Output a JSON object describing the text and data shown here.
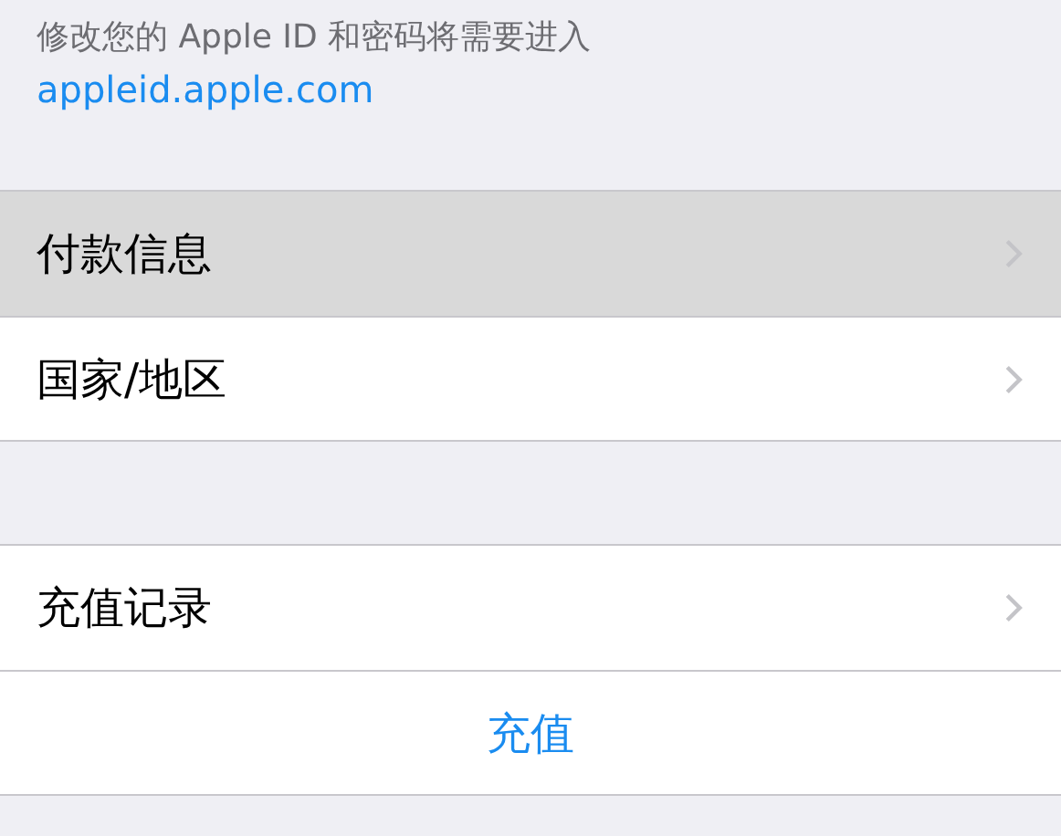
{
  "footer_note": {
    "text": "修改您的 Apple ID 和密码将需要进入",
    "link": "appleid.apple.com"
  },
  "groups": [
    {
      "items": [
        {
          "kind": "nav",
          "label": "付款信息",
          "selected": true
        },
        {
          "kind": "nav",
          "label": "国家/地区",
          "selected": false
        }
      ]
    },
    {
      "items": [
        {
          "kind": "nav",
          "label": "充值记录",
          "selected": false
        },
        {
          "kind": "action",
          "label": "充值",
          "selected": false
        }
      ]
    }
  ]
}
